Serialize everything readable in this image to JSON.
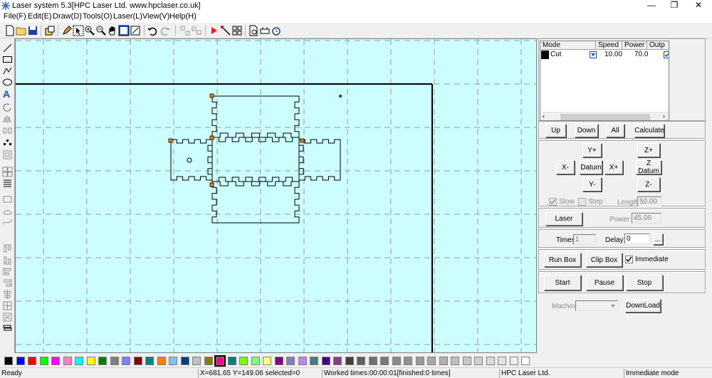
{
  "window": {
    "title": "Laser system 5.3[HPC Laser Ltd. www.hpclaser.co.uk]",
    "controls": [
      "—",
      "❐",
      "✕"
    ]
  },
  "menu": [
    "File(F)",
    "Edit(E)",
    "Draw(D)",
    "Tools(O)",
    "Laser(L)",
    "View(V)",
    "Help(H)"
  ],
  "layers": {
    "headers": [
      "Mode",
      "Speed",
      "Power",
      "Outp"
    ],
    "rows": [
      {
        "color": "#000000",
        "mode": "Cut",
        "speed": "10.00",
        "power": "70.0"
      }
    ]
  },
  "buttons": {
    "up": "Up",
    "down": "Down",
    "all": "All",
    "calculate": "Calculate",
    "y_plus": "Y+",
    "z_plus": "Z+",
    "x_minus": "X-",
    "datum": "Datum",
    "x_plus": "X+",
    "z_datum": "Z Datum",
    "y_minus": "Y-",
    "z_minus": "Z-",
    "laser": "Laser",
    "run_box": "Run Box",
    "clip_box": "Clip Box",
    "start": "Start",
    "pause": "Pause",
    "stop": "Stop",
    "download": "DownLoad",
    "ellipsis": "..."
  },
  "labels": {
    "slow": "Slow",
    "step": "Step",
    "length": "Length:",
    "power": "Power",
    "times": "Times:",
    "delay": "Delay:",
    "immediate": "Immediate",
    "machine": "Machine:"
  },
  "values": {
    "length": "50.00",
    "power": "45.00",
    "times": "1",
    "delay": "0"
  },
  "palette": [
    "#000000",
    "#0000ff",
    "#ff0000",
    "#00ff00",
    "#ff00ff",
    "#ff80c0",
    "#00ffff",
    "#ffff00",
    "#008000",
    "#808080",
    "#8080ff",
    "#800000",
    "#008080",
    "#ff8000",
    "#80c0ff",
    "#004080",
    "#c0c0c0",
    "#808000",
    "#ff0080",
    "#008080",
    "#80ff00",
    "#80ff80",
    "#ffff80",
    "#800080",
    "#8080c0",
    "#c080ff",
    "#408080",
    "#400080",
    "#804080",
    "#404040",
    "#606060",
    "#707070",
    "#7a7a7a",
    "#888888",
    "#909090",
    "#9a9a9a",
    "#a8a8a8",
    "#b0b0b0",
    "#c0c0c0",
    "#c8c8c8",
    "#d0d0d0",
    "#dcdcdc",
    "#e4e4e4",
    "#eeeeee",
    "#ffffff"
  ],
  "status": {
    "ready": "Ready",
    "coords": "X=681.65 Y=149.06 selected=0",
    "worked": "Worked times:00:00:01[finished:0 times]",
    "company": "HPC Laser Ltd.",
    "mode": "Immediate mode"
  }
}
